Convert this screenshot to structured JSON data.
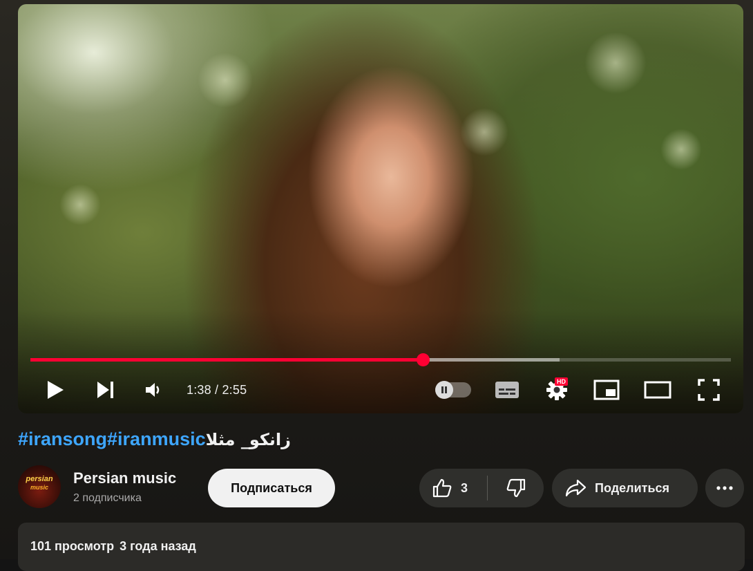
{
  "player": {
    "current_time": "1:38",
    "duration": "2:55",
    "time_separator": " / ",
    "played_fraction": 0.56,
    "buffered_fraction": 0.755,
    "hd_badge": "HD",
    "accent_color": "#ff0033"
  },
  "video": {
    "hashtags": [
      "#iransong",
      "#iranmusic"
    ],
    "title": "زانکو_ مثلا"
  },
  "channel": {
    "name": "Persian music",
    "subscribers": "2 подписчика",
    "avatar_text_line1": "persian",
    "avatar_text_line2": "music"
  },
  "actions": {
    "subscribe_label": "Подписаться",
    "like_count": "3",
    "share_label": "Поделиться"
  },
  "description": {
    "views": "101 просмотр",
    "published": "3 года назад"
  },
  "icons": {
    "play": "play-icon",
    "next": "next-icon",
    "volume": "volume-icon",
    "autoplay": "autoplay-toggle",
    "subtitles": "subtitles-icon",
    "settings": "gear-icon",
    "miniplayer": "miniplayer-icon",
    "theater": "theater-mode-icon",
    "fullscreen": "fullscreen-icon",
    "like": "thumbs-up-icon",
    "dislike": "thumbs-down-icon",
    "share": "share-arrow-icon",
    "more": "more-dots-icon"
  }
}
